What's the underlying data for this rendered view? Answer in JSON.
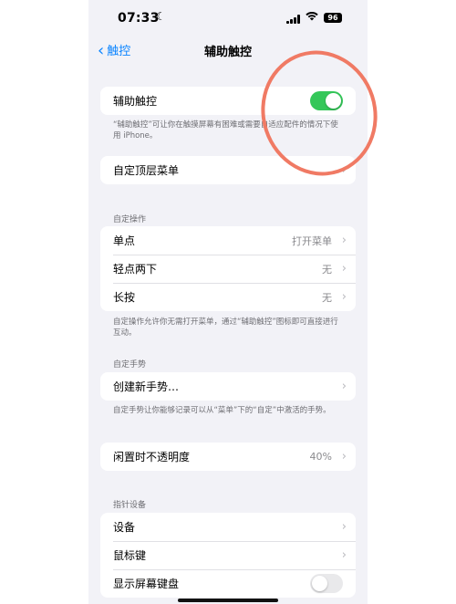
{
  "status": {
    "time": "07:33",
    "battery": "96"
  },
  "nav": {
    "back_label": "触控",
    "title": "辅助触控"
  },
  "assistive": {
    "label": "辅助触控",
    "toggle_on": true,
    "footnote": "“辅助触控”可让你在触摸屏幕有困难或需要自适应配件的情况下使用 iPhone。"
  },
  "top_menu": {
    "label": "自定顶层菜单"
  },
  "custom_actions": {
    "header": "自定操作",
    "rows": [
      {
        "label": "单点",
        "value": "打开菜单"
      },
      {
        "label": "轻点两下",
        "value": "无"
      },
      {
        "label": "长按",
        "value": "无"
      }
    ],
    "footnote": "自定操作允许你无需打开菜单，通过“辅助触控”图标即可直接进行互动。"
  },
  "custom_gestures": {
    "header": "自定手势",
    "create_label": "创建新手势…",
    "footnote": "自定手势让你能够记录可以从“菜单”下的“自定”中激活的手势。"
  },
  "idle_opacity": {
    "label": "闲置时不透明度",
    "value": "40%"
  },
  "pointer": {
    "header": "指针设备",
    "rows": [
      {
        "label": "设备"
      },
      {
        "label": "鼠标键"
      },
      {
        "label": "显示屏幕键盘",
        "toggle_on": false
      }
    ]
  },
  "colors": {
    "accent": "#0a84ff",
    "toggle_on": "#34c759",
    "annotation": "#f07a64"
  }
}
